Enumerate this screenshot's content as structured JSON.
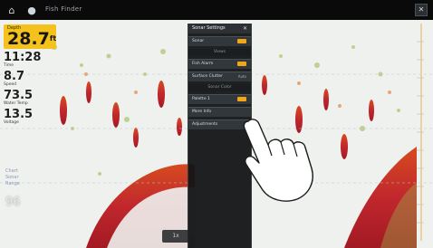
{
  "topbar": {
    "title": "Fish Finder",
    "home_icon": "home-icon",
    "pin_icon": "pin-icon",
    "close_icon": "close-icon"
  },
  "data_overlay": {
    "depth_label": "Depth",
    "depth_value": "28.7",
    "depth_unit": "ft",
    "time_value": "11:28",
    "time_label": "Time",
    "speed_value": "8.7",
    "speed_label": "Speed",
    "temp_value": "73.5",
    "temp_label": "Water Temp",
    "voltage_value": "13.5",
    "voltage_label": "Voltage",
    "range_lines": [
      "Chart",
      "Sonar",
      "Range"
    ],
    "bottom_depth": "96"
  },
  "menu": {
    "title": "Sonar Settings",
    "items": [
      {
        "label": "Sonar",
        "type": "toggle"
      },
      {
        "section": "Views"
      },
      {
        "label": "Fish Alarm",
        "type": "toggle"
      },
      {
        "label": "Surface Clutter",
        "type": "value",
        "value": "Auto"
      },
      {
        "section": "Sonar Color"
      },
      {
        "label": "Palette 1",
        "type": "toggle"
      },
      {
        "label": "More Info",
        "type": "none"
      },
      {
        "label": "Adjustments",
        "type": "none"
      }
    ]
  },
  "zoom": {
    "label": "1x"
  },
  "colors": {
    "accent": "#f0a81a",
    "depth_box": "#f4c21b",
    "sonar_red": "#c1272d",
    "sonar_green": "#9bb54a",
    "menu_bg": "#121416"
  }
}
